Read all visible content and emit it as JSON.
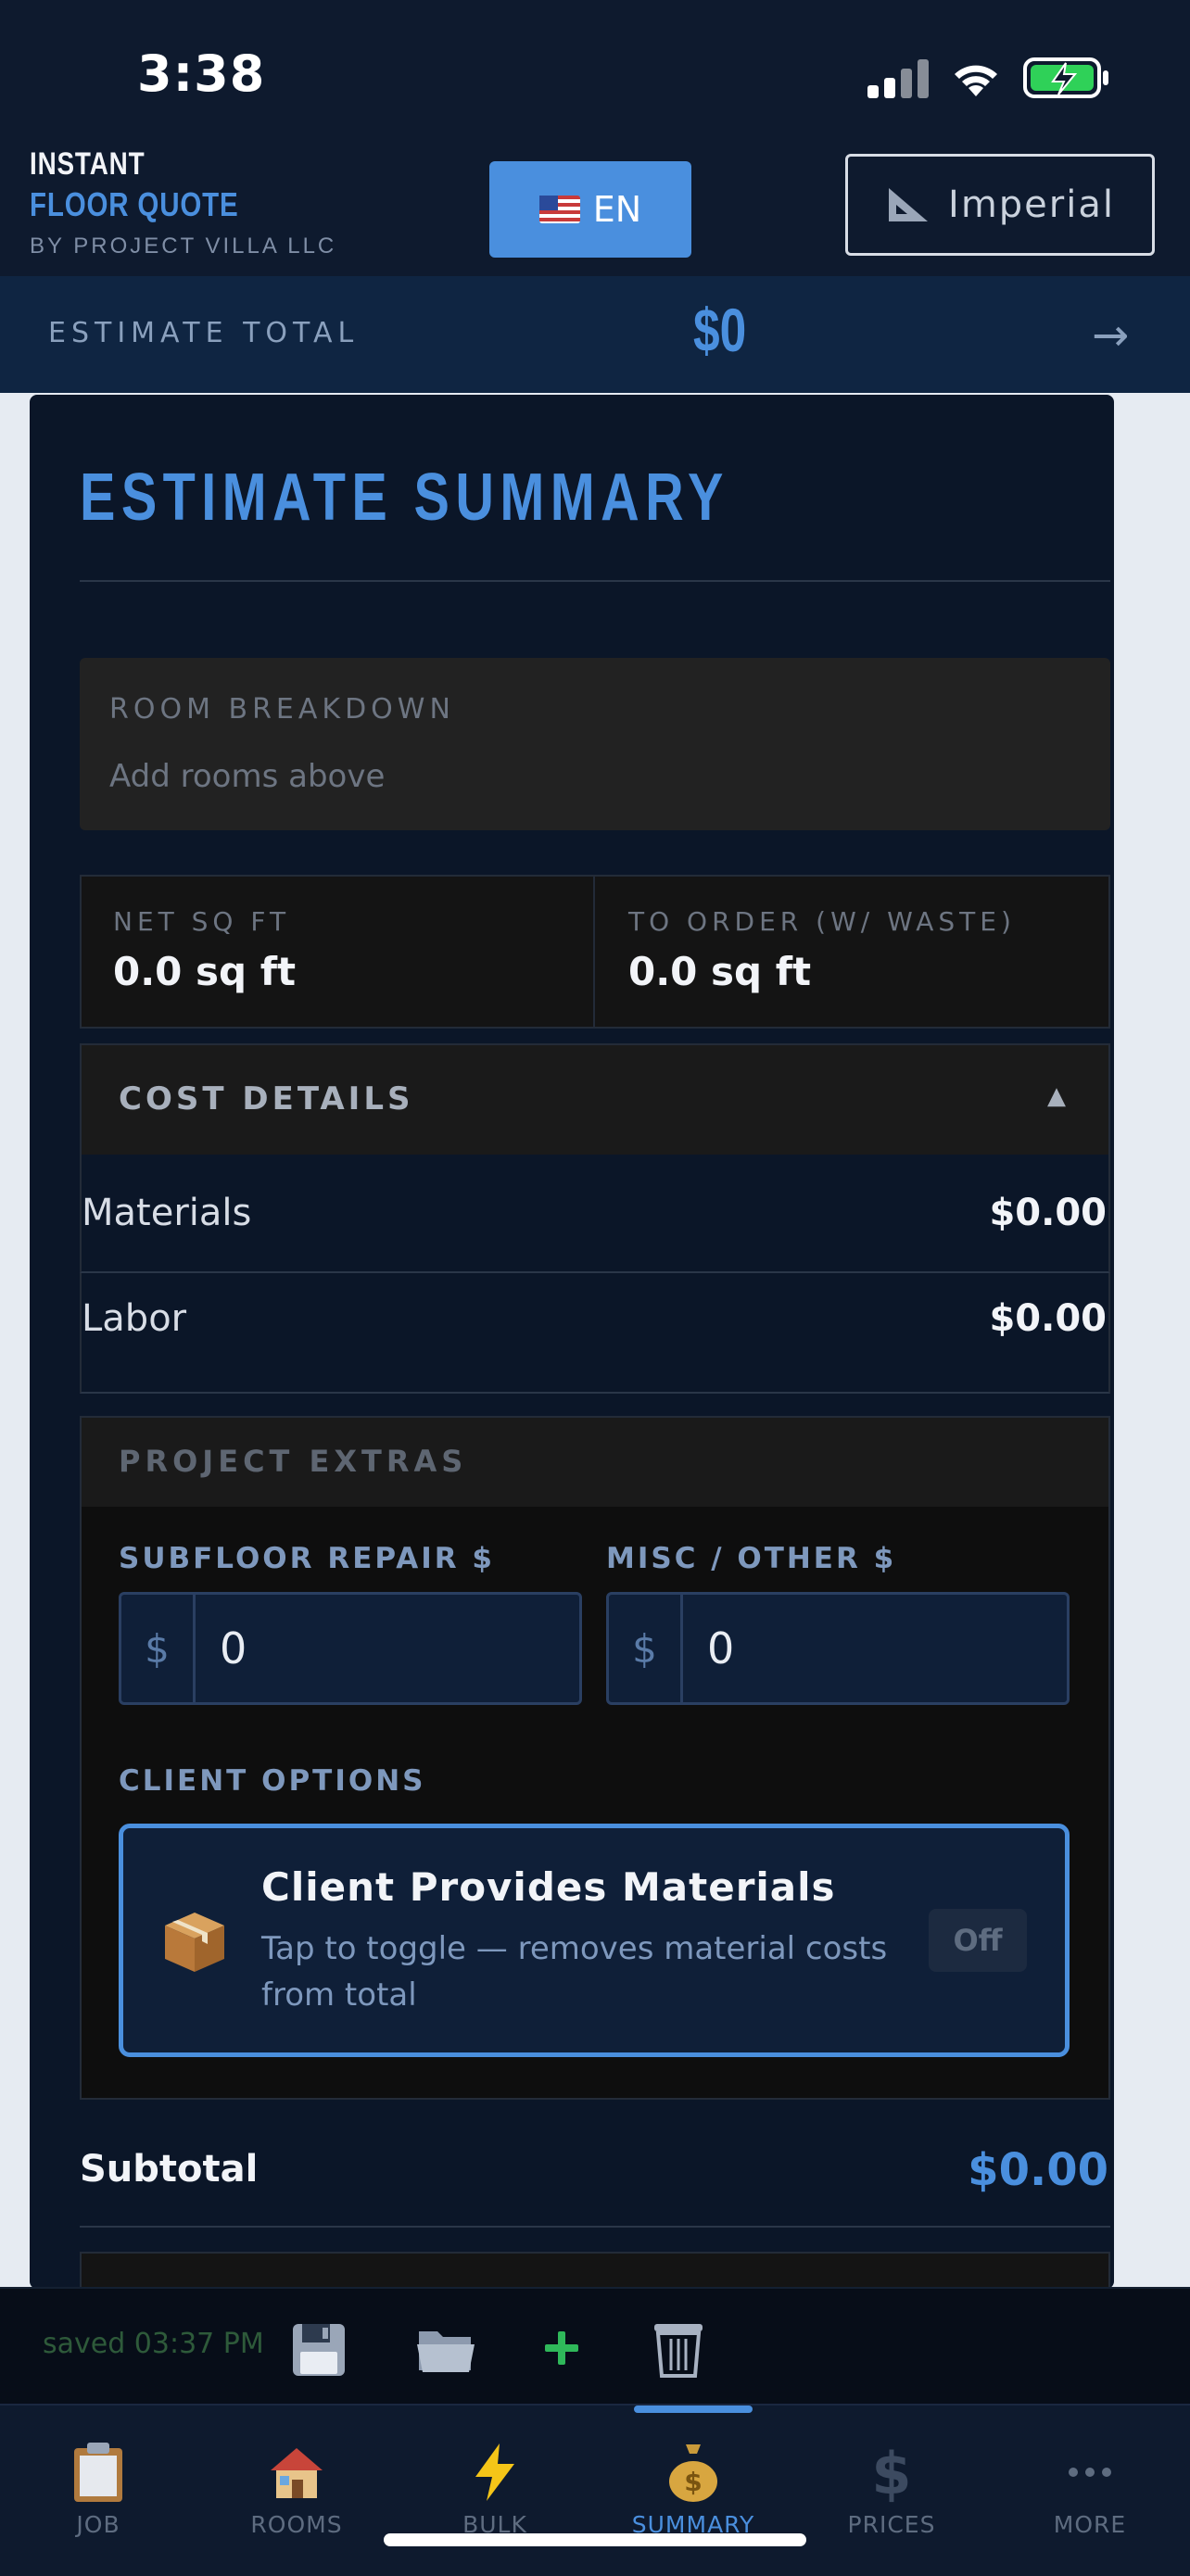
{
  "status_bar": {
    "time": "3:38"
  },
  "header": {
    "brand_line1": "INSTANT",
    "brand_line2": "FLOOR QUOTE",
    "brand_line3": "BY PROJECT VILLA LLC",
    "language_label": "EN",
    "units_label": "Imperial"
  },
  "estimate_bar": {
    "label": "ESTIMATE TOTAL",
    "value": "$0",
    "arrow": "→"
  },
  "summary": {
    "title": "ESTIMATE SUMMARY",
    "room_breakdown_title": "ROOM BREAKDOWN",
    "room_breakdown_empty": "Add rooms above",
    "net_sqft_label": "NET SQ FT",
    "net_sqft_value": "0.0 sq ft",
    "to_order_label": "TO ORDER (W/ WASTE)",
    "to_order_value": "0.0 sq ft",
    "cost_details_title": "COST DETAILS",
    "cost_details_caret": "▲",
    "cost_rows": [
      {
        "label": "Materials",
        "value": "$0.00"
      },
      {
        "label": "Labor",
        "value": "$0.00"
      }
    ],
    "extras_title": "PROJECT EXTRAS",
    "subfloor_label": "SUBFLOOR REPAIR $",
    "subfloor_value": "0",
    "misc_label": "MISC / OTHER $",
    "misc_value": "0",
    "currency_prefix": "$",
    "client_options_label": "CLIENT OPTIONS",
    "client_provides_title": "Client Provides Materials",
    "client_provides_desc": "Tap to toggle — removes material costs from total",
    "client_provides_state": "Off",
    "subtotal_label": "Subtotal",
    "subtotal_value": "$0.00"
  },
  "action_bar": {
    "saved_text": "saved 03:37 PM"
  },
  "tabs": [
    {
      "label": "JOB",
      "icon": "clipboard-icon"
    },
    {
      "label": "ROOMS",
      "icon": "house-icon"
    },
    {
      "label": "BULK",
      "icon": "lightning-icon"
    },
    {
      "label": "SUMMARY",
      "icon": "money-bag-icon"
    },
    {
      "label": "PRICES",
      "icon": "dollar-icon"
    },
    {
      "label": "MORE",
      "icon": "more-icon"
    }
  ],
  "active_tab": "SUMMARY",
  "colors": {
    "accent": "#4a8fde",
    "background": "#0b1628",
    "success": "#2fb85a"
  }
}
